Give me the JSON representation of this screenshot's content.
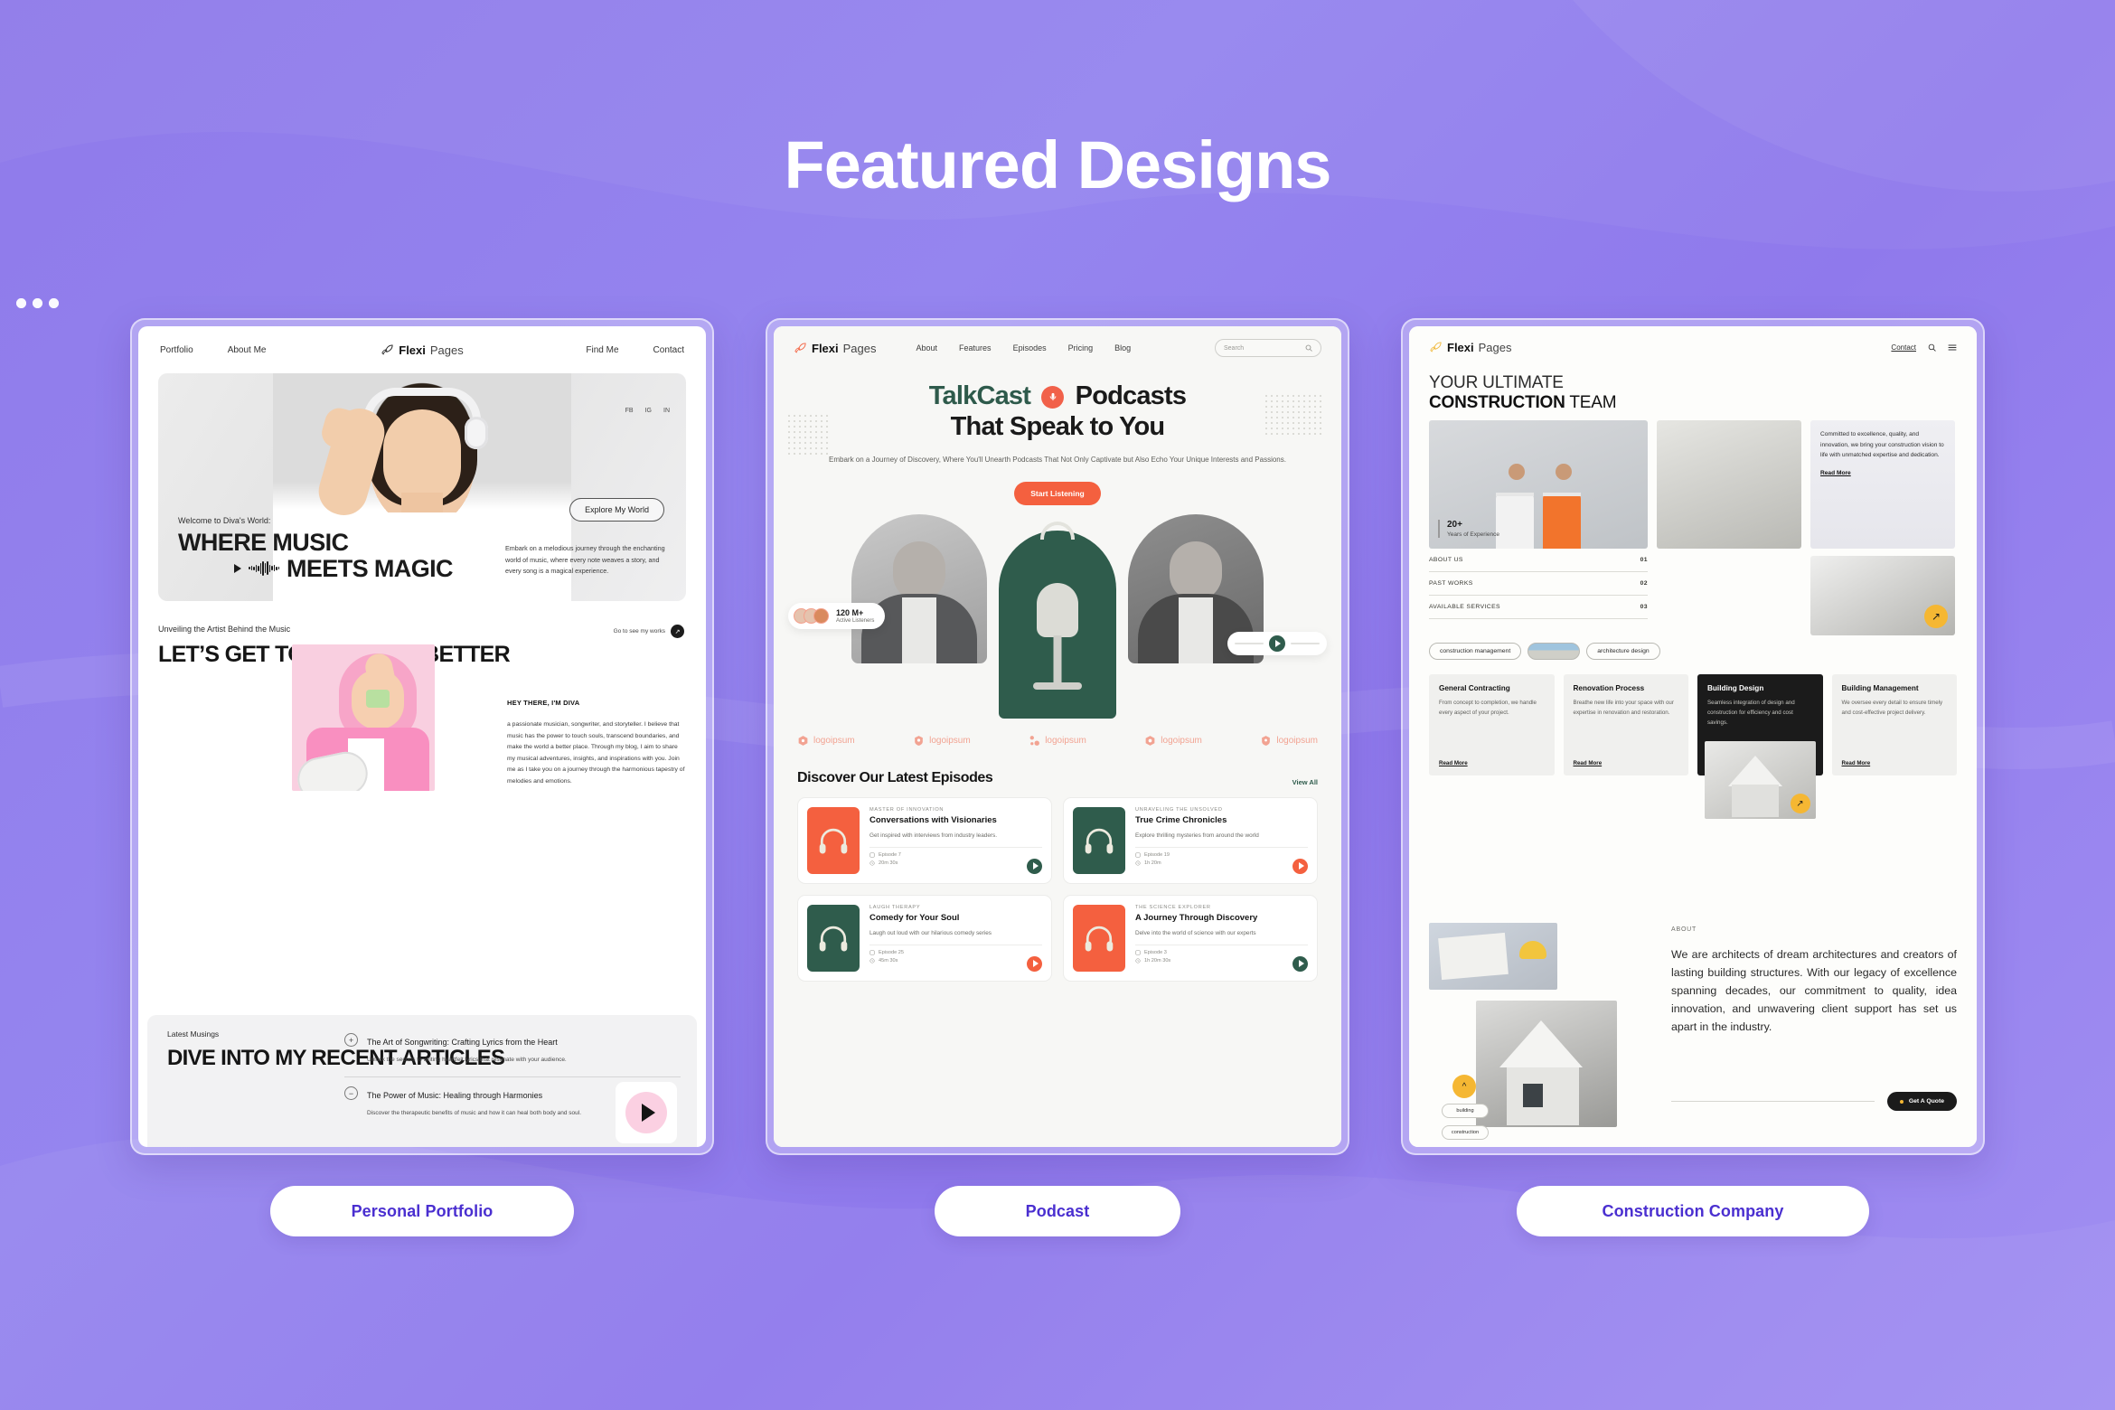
{
  "page": {
    "title": "Featured Designs",
    "background_color": "#8f7aea",
    "accent_color": "#4a2fd0"
  },
  "cards": [
    {
      "label": "Personal Portfolio",
      "brand": {
        "bold": "Flexi",
        "light": "Pages"
      },
      "nav_left": [
        "Portfolio",
        "About Me"
      ],
      "nav_right": [
        "Find Me",
        "Contact"
      ],
      "social": [
        "FB",
        "IG",
        "IN"
      ],
      "hero": {
        "kicker": "Welcome to Diva's World:",
        "title_line1": "WHERE MUSIC",
        "title_line2": "MEETS MAGIC",
        "cta": "Explore My World",
        "body": "Embark on a melodious journey through the enchanting world of music, where every note weaves a story, and every song is a magical experience."
      },
      "about": {
        "label": "Unveiling the Artist Behind the Music",
        "heading": "LET’S GET TO KNOW ME BETTER",
        "goto": "Go to see my works",
        "bio_title": "HEY THERE, I'M DIVA",
        "bio_body": "a passionate musician, songwriter, and storyteller. I believe that music has the power to touch souls, transcend boundaries, and make the world a better place. Through my blog, I aim to share my musical adventures, insights, and inspirations with you. Join me as I take you on a journey through the harmonious tapestry of melodies and emotions."
      },
      "articles": {
        "label": "Latest Musings",
        "heading": "DIVE INTO MY RECENT ARTICLES",
        "items": [
          {
            "sign": "+",
            "title": "The Art of Songwriting: Crafting Lyrics from the Heart",
            "desc": "Unlock the secrets to writing heartfelt lyrics that resonate with your audience."
          },
          {
            "sign": "−",
            "title": "The Power of Music: Healing through Harmonies",
            "desc": "Discover the therapeutic benefits of music and how it can heal both body and soul."
          }
        ]
      }
    },
    {
      "label": "Podcast",
      "brand": {
        "bold": "Flexi",
        "light": "Pages"
      },
      "nav": [
        "About",
        "Features",
        "Episodes",
        "Pricing",
        "Blog"
      ],
      "search_placeholder": "Search",
      "hero": {
        "title_green": "TalkCast",
        "title_dark": "Podcasts",
        "title_line2": "That Speak to You",
        "subtitle": "Embark on a Journey of Discovery, Where You'll Unearth Podcasts That Not Only Captivate but Also Echo Your Unique Interests and Passions.",
        "cta": "Start Listening",
        "stat_number": "120 M+",
        "stat_label": "Active Listeners"
      },
      "logos": [
        "logoipsum",
        "logoipsum",
        "logoipsum",
        "logoipsum",
        "logoipsum"
      ],
      "episodes_heading": "Discover Our Latest Episodes",
      "episodes_view_all": "View All",
      "episodes": [
        {
          "kicker": "MASTER OF INNOVATION",
          "title": "Conversations with Visionaries",
          "desc": "Get inspired with interviews from industry leaders.",
          "episode": "Episode 7",
          "duration": "20m 30s",
          "art_color": "orange",
          "play_color": "green"
        },
        {
          "kicker": "UNRAVELING THE UNSOLVED",
          "title": "True Crime Chronicles",
          "desc": "Explore thrilling mysteries from around the world",
          "episode": "Episode 19",
          "duration": "1h 20m",
          "art_color": "green",
          "play_color": "orange"
        },
        {
          "kicker": "LAUGH THERAPY",
          "title": "Comedy for Your Soul",
          "desc": "Laugh out loud with our hilarious comedy series",
          "episode": "Episode 25",
          "duration": "45m 30s",
          "art_color": "green",
          "play_color": "orange"
        },
        {
          "kicker": "THE SCIENCE EXPLORER",
          "title": "A Journey Through Discovery",
          "desc": "Delve into the world of science with our experts",
          "episode": "Episode 3",
          "duration": "1h 20m 30s",
          "art_color": "orange",
          "play_color": "green"
        }
      ]
    },
    {
      "label": "Construction Company",
      "brand": {
        "bold": "Flexi",
        "light": "Pages"
      },
      "nav_right": [
        "Contact"
      ],
      "hero": {
        "title_line1": "YOUR ULTIMATE",
        "title_line2_bold": "CONSTRUCTION",
        "title_line2_rest": " TEAM",
        "note": "Committed to excellence, quality, and innovation, we bring your construction vision to life with unmatched expertise and dedication.",
        "note_link": "Read More",
        "experience_number": "20+",
        "experience_label": "Years of Experience"
      },
      "menu_rows": [
        {
          "label": "ABOUT US",
          "num": "01"
        },
        {
          "label": "PAST WORKS",
          "num": "02"
        },
        {
          "label": "AVAILABLE SERVICES",
          "num": "03"
        }
      ],
      "tags": [
        "construction management",
        "architecture design"
      ],
      "services": [
        {
          "title": "General Contracting",
          "desc": "From concept to completion, we handle every aspect of your project.",
          "link": "Read More",
          "dark": false
        },
        {
          "title": "Renovation Process",
          "desc": "Breathe new life into your space with our expertise in renovation and restoration.",
          "link": "Read More",
          "dark": false
        },
        {
          "title": "Building Design",
          "desc": "Seamless integration of design and construction for efficiency and cost savings.",
          "link": "",
          "dark": true
        },
        {
          "title": "Building Management",
          "desc": "We oversee every detail to ensure timely and cost-effective project delivery.",
          "link": "Read More",
          "dark": false
        }
      ],
      "about": {
        "label": "ABOUT",
        "body": "We are architects of dream architectures and creators of lasting building structures. With our legacy of excellence spanning decades, our commitment to quality, idea innovation, and unwavering client support has set us apart in the industry.",
        "cta": "Get A Quote"
      },
      "mini_tags": [
        "building",
        "construction"
      ]
    }
  ]
}
